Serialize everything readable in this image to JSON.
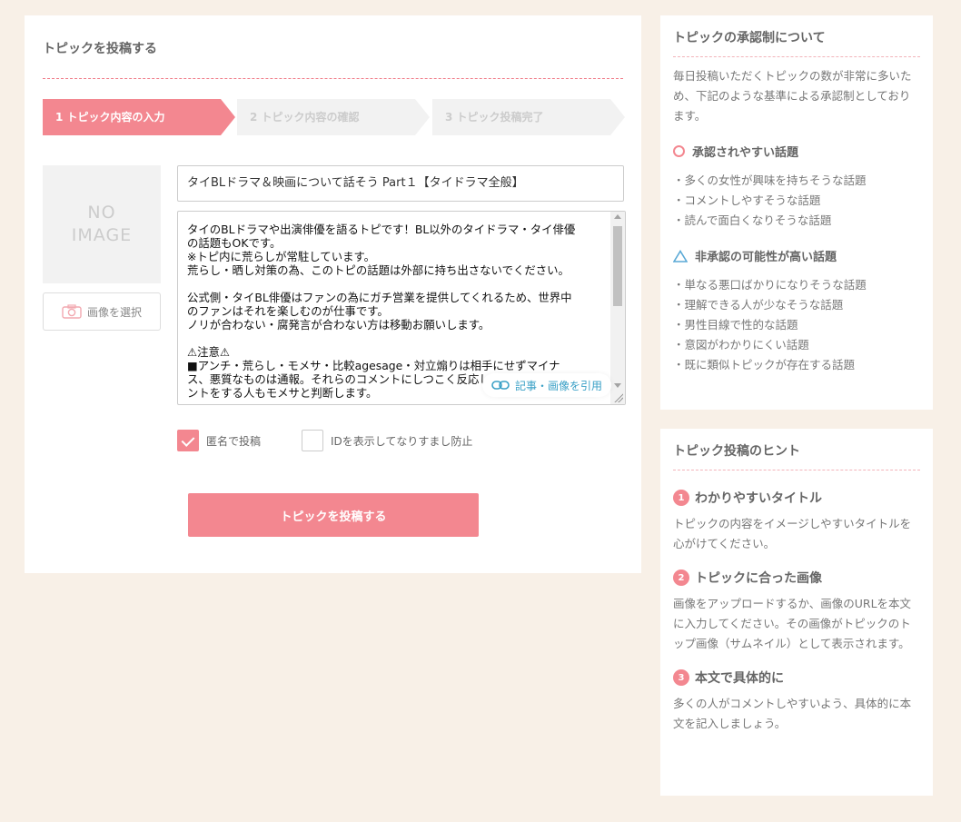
{
  "main": {
    "title": "トピックを投稿する",
    "steps": [
      {
        "label": "1 トピック内容の入力"
      },
      {
        "label": "2 トピック内容の確認"
      },
      {
        "label": "3 トピック投稿完了"
      }
    ],
    "no_image_line1": "NO",
    "no_image_line2": "IMAGE",
    "select_image_label": "画像を選択",
    "title_value": "タイBLドラマ＆映画について話そう Part１【タイドラマ全般】",
    "body_value": "タイのBLドラマや出演俳優を語るトピです！BL以外のタイドラマ・タイ俳優\nの話題もOKです。\n※トピ内に荒らしが常駐しています。\n荒らし・晒し対策の為、このトピの話題は外部に持ち出さないでください。\n\n公式側・タイBL俳優はファンの為にガチ営業を提供してくれるため、世界中\nのファンはそれを楽しむのが仕事です。\nノリが合わない・腐発言が合わない方は移動お願いします。\n\n⚠注意⚠\n■アンチ・荒らし・モメサ・比較agesage・対立煽りは相手にせずマイナ\nス、悪質なものは通報。それらのコメントにしつこく反応してモメ続けるコメ\nントをする人もモメサと判断します。",
    "cite_link_label": "記事・画像を引用",
    "checkbox_anonymous_label": "匿名で投稿",
    "checkbox_id_label": "IDを表示してなりすまし防止",
    "submit_label": "トピックを投稿する"
  },
  "sidebar": {
    "approval": {
      "title": "トピックの承認制について",
      "intro": "毎日投稿いただくトピックの数が非常に多いため、下記のような基準による承認制としております。",
      "approved_heading": "承認されやすい話題",
      "approved_items": [
        "・多くの女性が興味を持ちそうな話題",
        "・コメントしやすそうな話題",
        "・読んで面白くなりそうな話題"
      ],
      "rejected_heading": "非承認の可能性が高い話題",
      "rejected_items": [
        "・単なる悪口ばかりになりそうな話題",
        "・理解できる人が少なそうな話題",
        "・男性目線で性的な話題",
        "・意図がわかりにくい話題",
        "・既に類似トピックが存在する話題"
      ]
    },
    "hints": {
      "title": "トピック投稿のヒント",
      "items": [
        {
          "num": "1",
          "heading": "わかりやすいタイトル",
          "text": "トピックの内容をイメージしやすいタイトルを心がけてください。"
        },
        {
          "num": "2",
          "heading": "トピックに合った画像",
          "text": "画像をアップロードするか、画像のURLを本文に入力してください。その画像がトピックのトップ画像（サムネイル）として表示されます。"
        },
        {
          "num": "3",
          "heading": "本文で具体的に",
          "text": "多くの人がコメントしやすいよう、具体的に本文を記入しましょう。"
        }
      ]
    }
  },
  "colors": {
    "accent": "#f38790",
    "background": "#f8f0e7",
    "link": "#3aa0c6",
    "triangle": "#5aa9d6"
  }
}
